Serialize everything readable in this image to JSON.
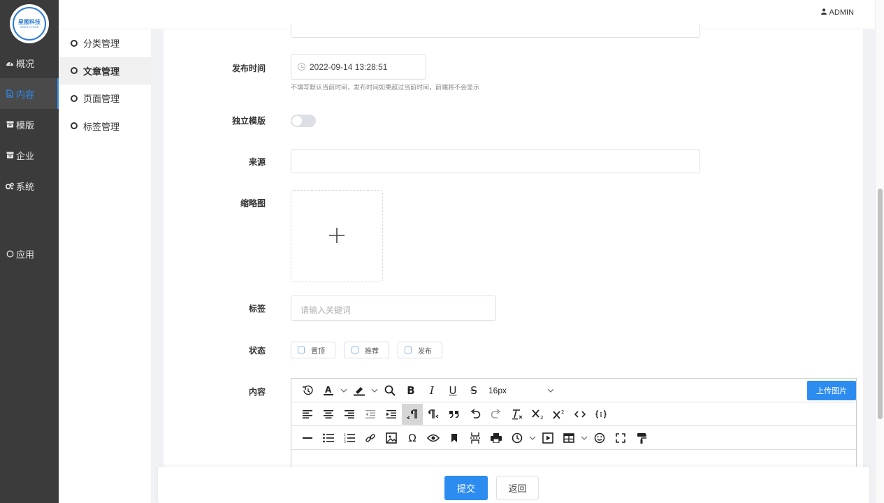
{
  "sidebar": {
    "logo_text": "星图科技",
    "logo_sub": "XINGTU TECH",
    "items": [
      {
        "label": "概况",
        "icon": "dashboard-icon"
      },
      {
        "label": "内容",
        "icon": "document-icon"
      },
      {
        "label": "模版",
        "icon": "template-icon"
      },
      {
        "label": "企业",
        "icon": "enterprise-icon"
      },
      {
        "label": "系统",
        "icon": "gears-icon"
      },
      {
        "label": "应用",
        "icon": "circle-icon"
      }
    ]
  },
  "submenu": {
    "items": [
      {
        "label": "分类管理"
      },
      {
        "label": "文章管理"
      },
      {
        "label": "页面管理"
      },
      {
        "label": "标签管理"
      }
    ]
  },
  "header": {
    "user": "ADMIN"
  },
  "form": {
    "publish_time": {
      "label": "发布时间",
      "value": "2022-09-14 13:28:51",
      "hint": "不填写默认当前时间，发布时间如果超过当前时间，前端将不会显示"
    },
    "independent_template": {
      "label": "独立模版",
      "enabled": false
    },
    "source": {
      "label": "来源",
      "value": ""
    },
    "thumbnail": {
      "label": "缩略图"
    },
    "tags": {
      "label": "标签",
      "placeholder": "请输入关键词"
    },
    "status": {
      "label": "状态",
      "options": [
        "置顶",
        "推荐",
        "发布"
      ]
    },
    "content": {
      "label": "内容",
      "font_size": "16px",
      "upload_image": "上传图片"
    }
  },
  "actions": {
    "submit": "提交",
    "back": "返回"
  },
  "colors": {
    "accent": "#2d8cf0",
    "sidebar_bg": "#3b3b3b"
  }
}
